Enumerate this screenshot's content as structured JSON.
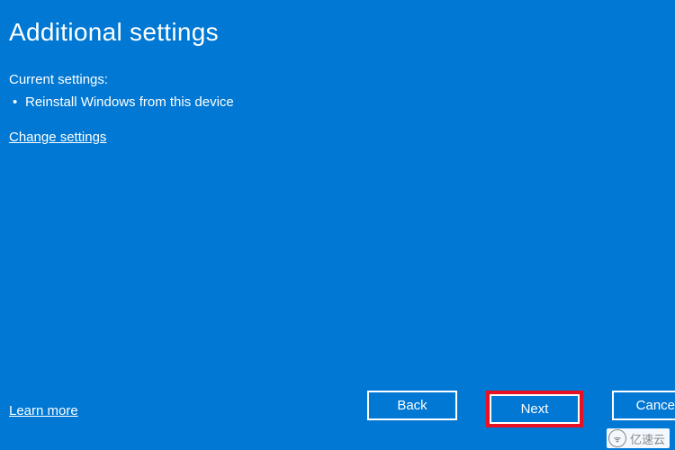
{
  "header": {
    "title": "Additional settings"
  },
  "content": {
    "subtitle": "Current settings:",
    "bullet1": "Reinstall Windows from this device",
    "change_link": "Change settings"
  },
  "footer": {
    "learn_more": "Learn more",
    "back_label": "Back",
    "next_label": "Next",
    "cancel_label": "Cancel"
  },
  "watermark": {
    "text": "亿速云"
  }
}
